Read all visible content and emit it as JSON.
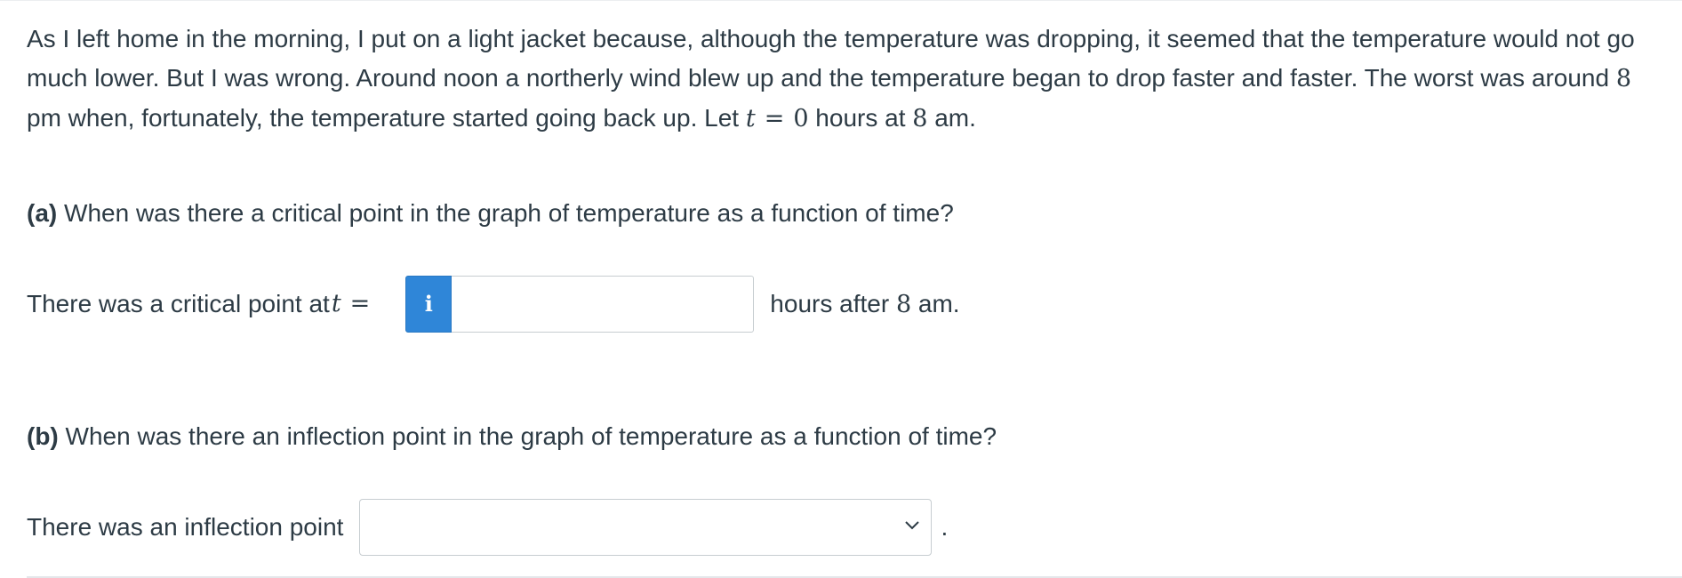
{
  "intro": {
    "part1": "As I left home in the morning, I put on a light jacket because, although the temperature was dropping, it seemed that the temperature would not go much lower. But I was wrong. Around noon a northerly wind blew up and the temperature began to drop faster and faster. The worst was around ",
    "eight": "8",
    "part2": " pm when, fortunately, the temperature started going back up. Let ",
    "var_t": "t",
    "equals": "=",
    "zero": "0",
    "part3": " hours at ",
    "eight_am": "8",
    "part4": " am."
  },
  "question_a": {
    "label": "(a)",
    "text": " When was there a critical point in the graph of temperature as a function of time?",
    "answer_prefix": "There was a critical point at ",
    "var_t": "t",
    "equals": "=",
    "info_icon": "info-icon",
    "input_value": "",
    "suffix_text": "hours after ",
    "suffix_eight": "8",
    "suffix_am": " am."
  },
  "question_b": {
    "label": "(b)",
    "text": " When was there an inflection point in the graph of temperature as a function of time?",
    "answer_prefix": "There was an inflection point",
    "select_value": "",
    "chevron_icon": "chevron-down-icon",
    "period": "."
  },
  "colors": {
    "text": "#2d3b45",
    "info_button": "#2f86d8",
    "border": "#c7cdd1"
  }
}
